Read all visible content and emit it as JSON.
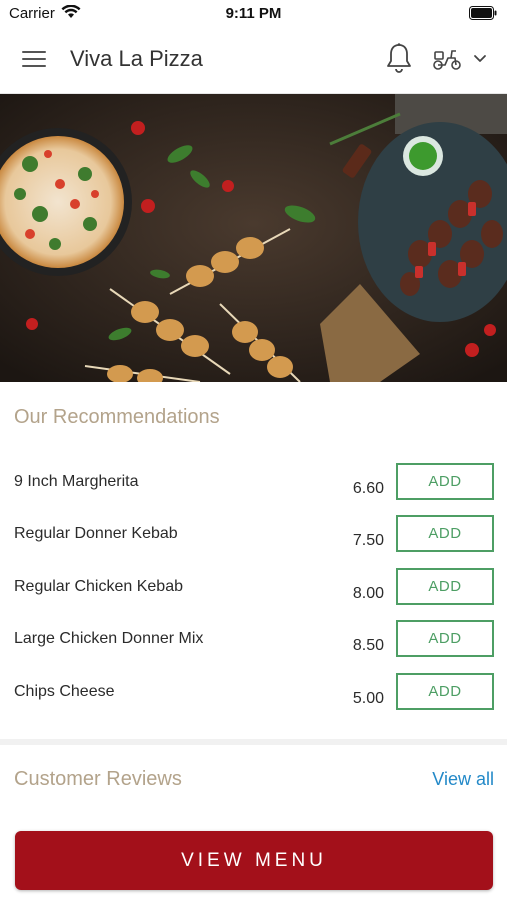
{
  "status_bar": {
    "carrier": "Carrier",
    "time": "9:11 PM"
  },
  "header": {
    "title": "Viva La Pizza"
  },
  "recommendations": {
    "title": "Our Recommendations",
    "add_label": "ADD",
    "items": [
      {
        "name": "9 Inch Margherita",
        "price": "6.60"
      },
      {
        "name": "Regular Donner Kebab",
        "price": "7.50"
      },
      {
        "name": "Regular Chicken Kebab",
        "price": "8.00"
      },
      {
        "name": "Large Chicken Donner Mix",
        "price": "8.50"
      },
      {
        "name": "Chips Cheese",
        "price": "5.00"
      }
    ]
  },
  "reviews": {
    "title": "Customer Reviews",
    "view_all": "View all"
  },
  "footer": {
    "view_menu": "VIEW MENU"
  },
  "colors": {
    "accent_red": "#a3101a",
    "add_green": "#4d9e64",
    "link_blue": "#2389c8",
    "section_title": "#b3a38b"
  }
}
